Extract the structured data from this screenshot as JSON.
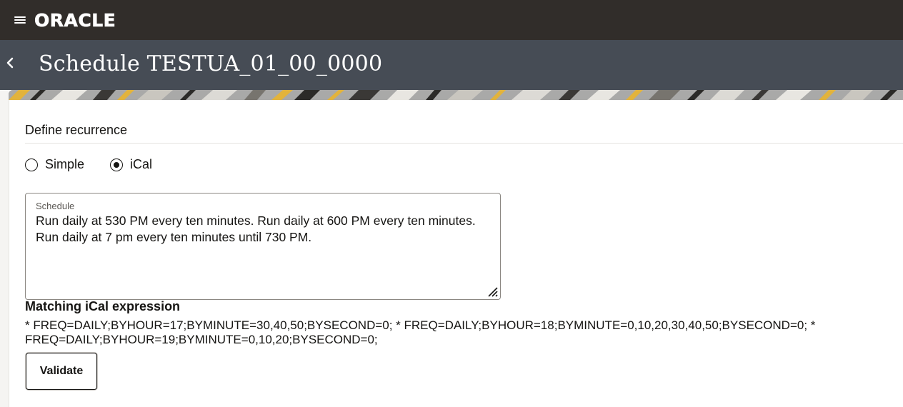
{
  "brand": {
    "logo_text": "ORACLE",
    "menu_icon": "hamburger-menu-icon"
  },
  "header": {
    "back_icon": "chevron-left-icon",
    "title": "Schedule TESTUA_01_00_0000"
  },
  "recurrence": {
    "section_title": "Define recurrence",
    "options": [
      {
        "label": "Simple",
        "selected": false
      },
      {
        "label": "iCal",
        "selected": true
      }
    ]
  },
  "schedule": {
    "label": "Schedule",
    "value": "Run daily at 530 PM every ten minutes. Run daily at 600 PM every ten minutes. Run daily at 7 pm every ten minutes until 730 PM."
  },
  "ical": {
    "title": "Matching iCal expression",
    "expression": "* FREQ=DAILY;BYHOUR=17;BYMINUTE=30,40,50;BYSECOND=0; * FREQ=DAILY;BYHOUR=18;BYMINUTE=0,10,20,30,40,50;BYSECOND=0; * FREQ=DAILY;BYHOUR=19;BYMINUTE=0,10,20;BYSECOND=0;"
  },
  "actions": {
    "validate_label": "Validate"
  },
  "colors": {
    "topbar": "#312d2a",
    "page_header": "#464c55",
    "text": "#161513"
  }
}
